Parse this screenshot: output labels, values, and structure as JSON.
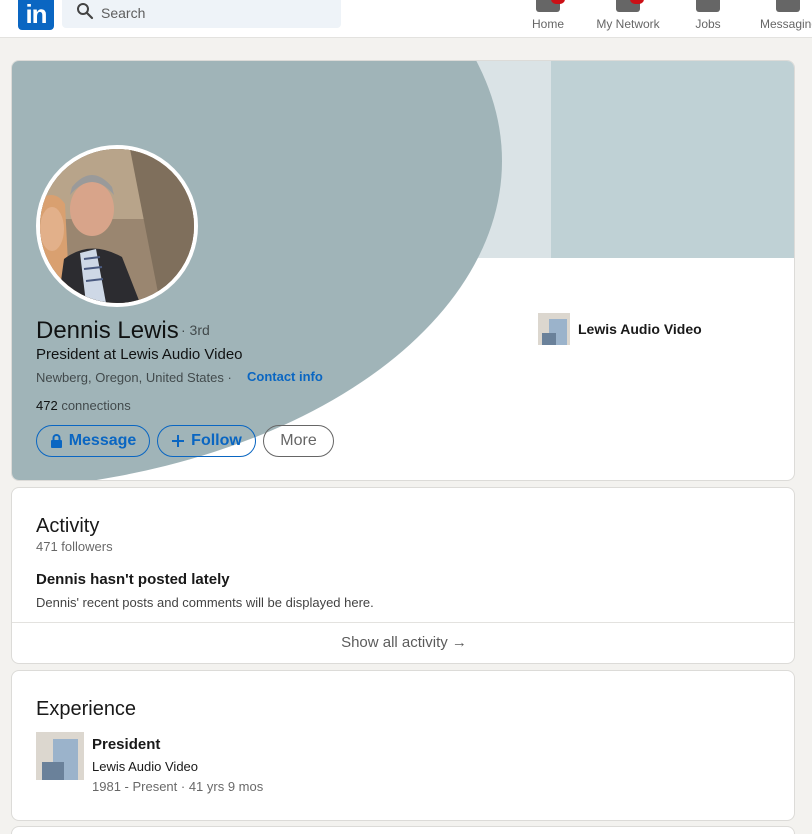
{
  "nav": {
    "logo_text": "in",
    "search_placeholder": "Search",
    "items": [
      {
        "label": "Home",
        "badge": ""
      },
      {
        "label": "My Network",
        "badge": ""
      },
      {
        "label": "Jobs",
        "badge": ""
      },
      {
        "label": "Messaging",
        "badge": ""
      }
    ]
  },
  "profile": {
    "name": "Dennis Lewis",
    "degree": "· 3rd",
    "headline": "President at Lewis Audio Video",
    "location": "Newberg, Oregon, United States ·",
    "contact_info": "Contact info",
    "connections_count": "472",
    "connections_label": "connections",
    "company": "Lewis Audio Video",
    "buttons": {
      "message": "Message",
      "follow": "Follow",
      "more": "More"
    }
  },
  "activity": {
    "title": "Activity",
    "followers": "471 followers",
    "empty_title": "Dennis hasn't posted lately",
    "empty_sub": "Dennis' recent posts and comments will be displayed here.",
    "show_all": "Show all activity →"
  },
  "experience": {
    "title": "Experience",
    "items": [
      {
        "role": "President",
        "company": "Lewis Audio Video",
        "dates": "1981 - Present · 41 yrs 9 mos"
      }
    ]
  },
  "colors": {
    "brand": "#0a66c2",
    "page_bg": "#f3f2ef",
    "banner_light": "#bfd1d5",
    "banner_dark": "#a0b4b8"
  },
  "icons": [
    "linkedin-logo",
    "search-icon",
    "home-icon",
    "network-icon",
    "jobs-icon",
    "messaging-icon",
    "lock-icon",
    "plus-icon",
    "arrow-right-icon"
  ]
}
